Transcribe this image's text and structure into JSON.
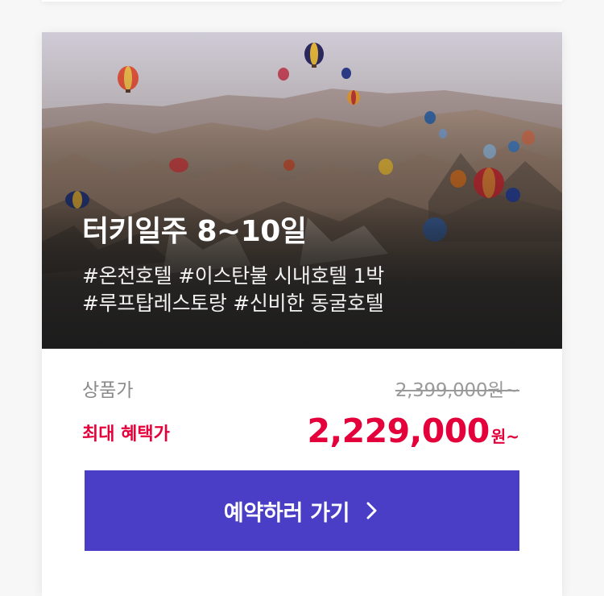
{
  "hero": {
    "image": "cappadocia-hot-air-balloons-photo",
    "title": "터키일주 8~10일",
    "tags": [
      "#온천호텔 #이스탄불 시내호텔 1박",
      "#루프탑레스토랑 #신비한 동굴호텔"
    ]
  },
  "pricing": {
    "original_label": "상품가",
    "original_price": "2,399,000원~",
    "sale_label": "최대 혜택가",
    "sale_price": "2,229,000",
    "sale_unit": "원~"
  },
  "cta": {
    "label": "예약하러 가기",
    "icon": "chevron-right-icon"
  },
  "colors": {
    "accent": "#4a3ec6",
    "sale": "#e4003a",
    "muted": "#8a8a8a"
  }
}
